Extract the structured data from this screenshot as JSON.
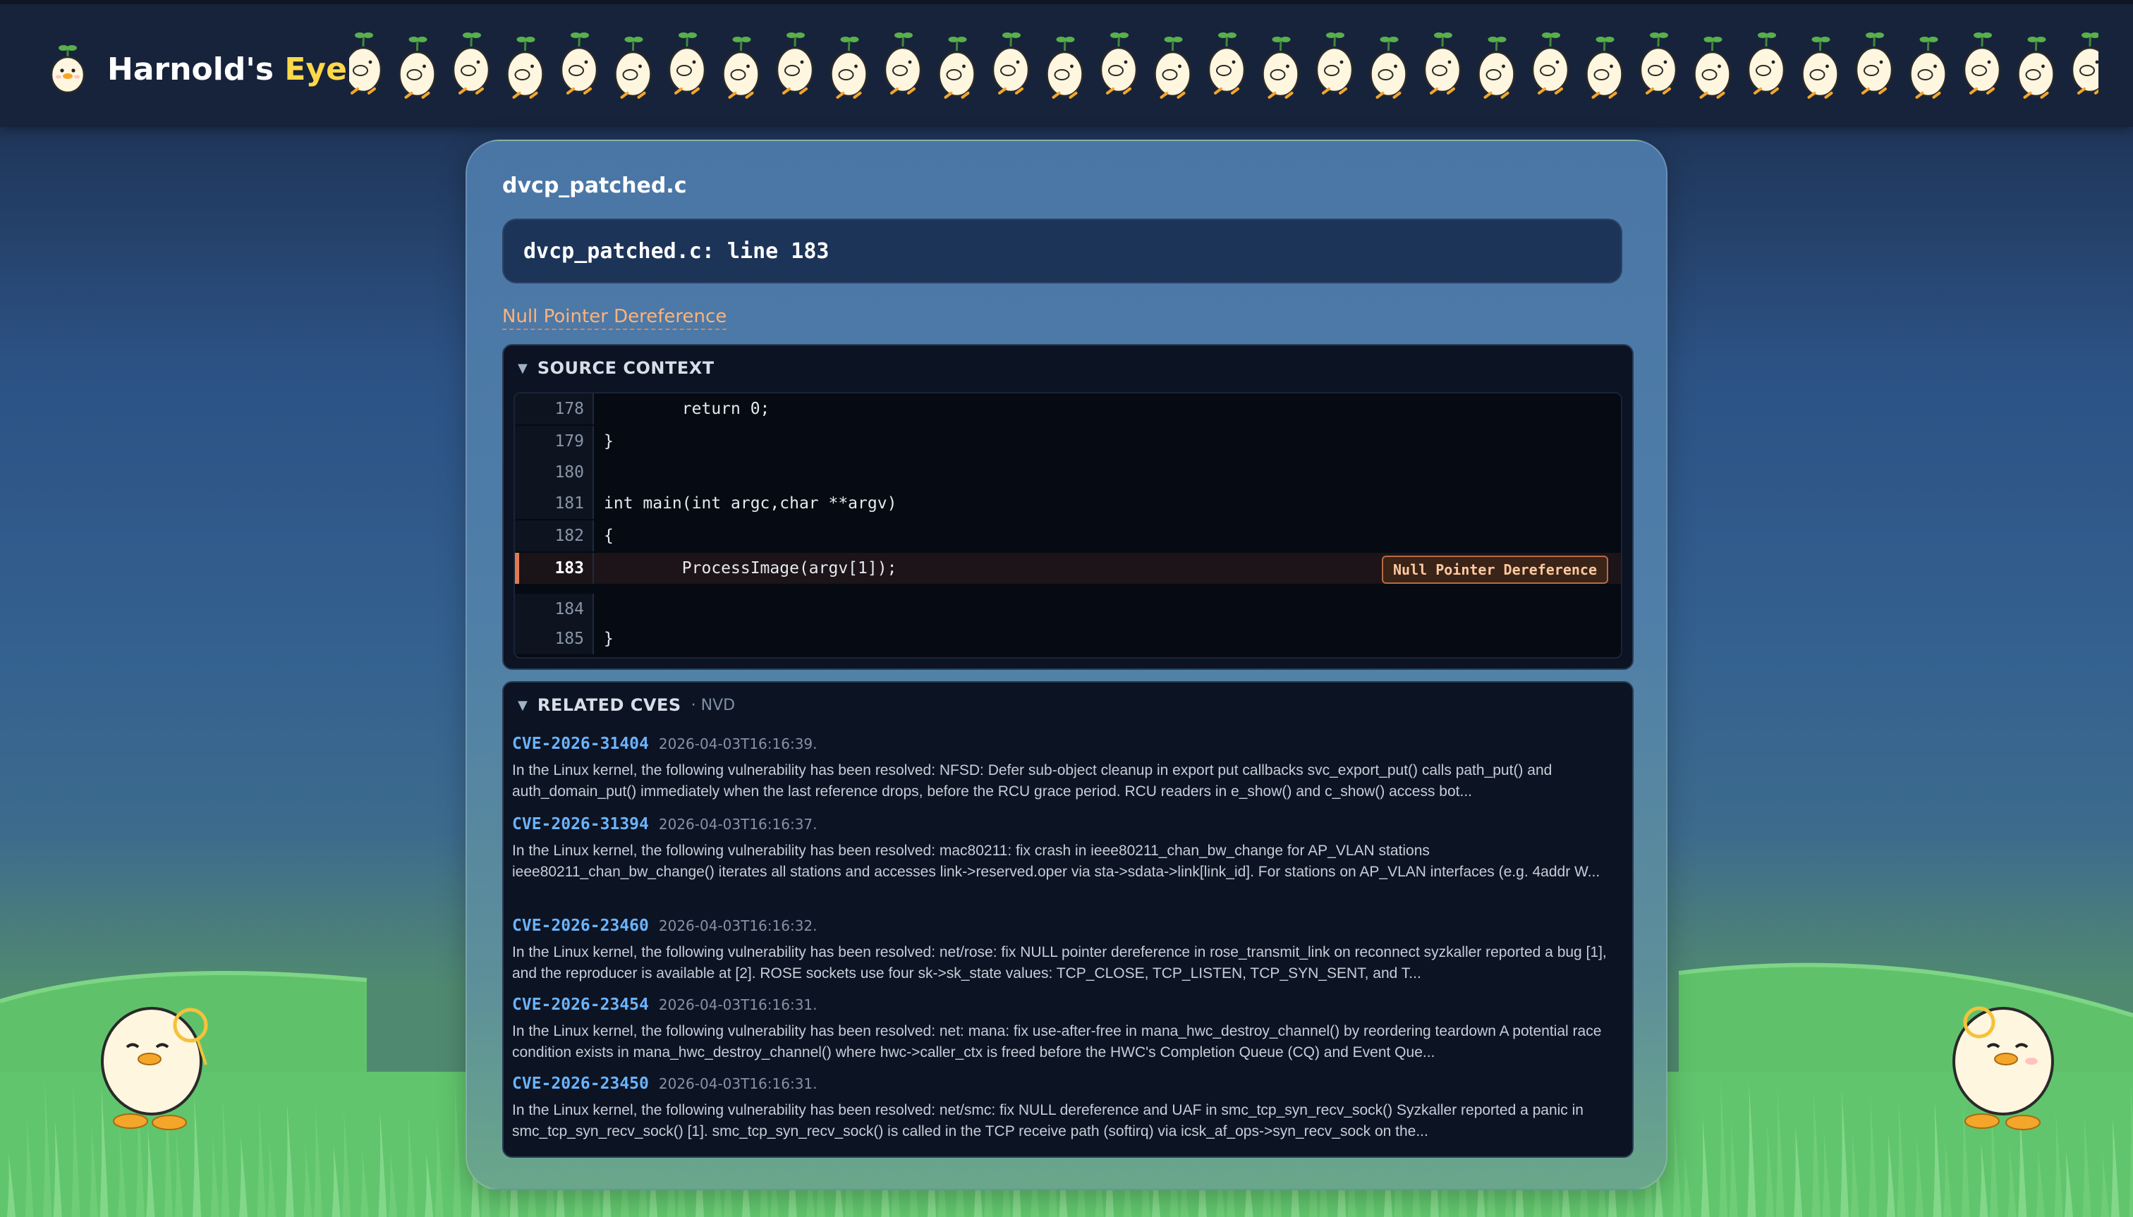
{
  "header": {
    "brand_name_part1": "Harnold's",
    "brand_name_part2": "Eye",
    "accent_color": "#ffd84a",
    "logo_icon": "duck-sprout-icon",
    "banner_icon": "duck-parade"
  },
  "file": {
    "title": "dvcp_patched.c",
    "location": "dvcp_patched.c: line 183",
    "vulnerability": "Null Pointer Dereference"
  },
  "source_context": {
    "title": "SOURCE CONTEXT",
    "lines": [
      {
        "num": "178",
        "code": "        return 0;"
      },
      {
        "num": "179",
        "code": "}"
      },
      {
        "num": "180",
        "code": ""
      },
      {
        "num": "181",
        "code": "int main(int argc,char **argv)"
      },
      {
        "num": "182",
        "code": "{"
      },
      {
        "num": "183",
        "code": "        ProcessImage(argv[1]);",
        "highlight": true,
        "badge": "Null Pointer Dereference"
      },
      {
        "num": "184",
        "code": ""
      },
      {
        "num": "185",
        "code": "}"
      }
    ]
  },
  "related_cves": {
    "title": "RELATED CVES",
    "source": "· NVD",
    "items": [
      {
        "id": "CVE-2026-31404",
        "date": "2026-04-03T16:16:39.",
        "description": "In the Linux kernel, the following vulnerability has been resolved: NFSD: Defer sub-object cleanup in export put callbacks svc_export_put() calls path_put() and auth_domain_put() immediately when the last reference drops, before the RCU grace period. RCU readers in e_show() and c_show() access bot..."
      },
      {
        "id": "CVE-2026-31394",
        "date": "2026-04-03T16:16:37.",
        "description": "In the Linux kernel, the following vulnerability has been resolved: mac80211: fix crash in ieee80211_chan_bw_change for AP_VLAN stations ieee80211_chan_bw_change() iterates all stations and accesses link->reserved.oper via sta->sdata->link[link_id]. For stations on AP_VLAN interfaces (e.g. 4addr W..."
      },
      {
        "id": "CVE-2026-23460",
        "date": "2026-04-03T16:16:32.",
        "description": "In the Linux kernel, the following vulnerability has been resolved: net/rose: fix NULL pointer dereference in rose_transmit_link on reconnect syzkaller reported a bug [1], and the reproducer is available at [2]. ROSE sockets use four sk->sk_state values: TCP_CLOSE, TCP_LISTEN, TCP_SYN_SENT, and T..."
      },
      {
        "id": "CVE-2026-23454",
        "date": "2026-04-03T16:16:31.",
        "description": "In the Linux kernel, the following vulnerability has been resolved: net: mana: fix use-after-free in mana_hwc_destroy_channel() by reordering teardown A potential race condition exists in mana_hwc_destroy_channel() where hwc->caller_ctx is freed before the HWC's Completion Queue (CQ) and Event Que..."
      },
      {
        "id": "CVE-2026-23450",
        "date": "2026-04-03T16:16:31.",
        "description": "In the Linux kernel, the following vulnerability has been resolved: net/smc: fix NULL dereference and UAF in smc_tcp_syn_recv_sock() Syzkaller reported a panic in smc_tcp_syn_recv_sock() [1]. smc_tcp_syn_recv_sock() is called in the TCP receive path (softirq) via icsk_af_ops->syn_recv_sock on the..."
      }
    ]
  },
  "colors": {
    "highlight_line": "#e07a52",
    "cve_link": "#6bb3ff",
    "vuln_link": "#ffb27a",
    "grass": "#5fc26a"
  },
  "decorations": {
    "left_mascot": "duck-monocle-mascot-icon",
    "right_mascot": "duck-monocle-mascot-icon"
  }
}
